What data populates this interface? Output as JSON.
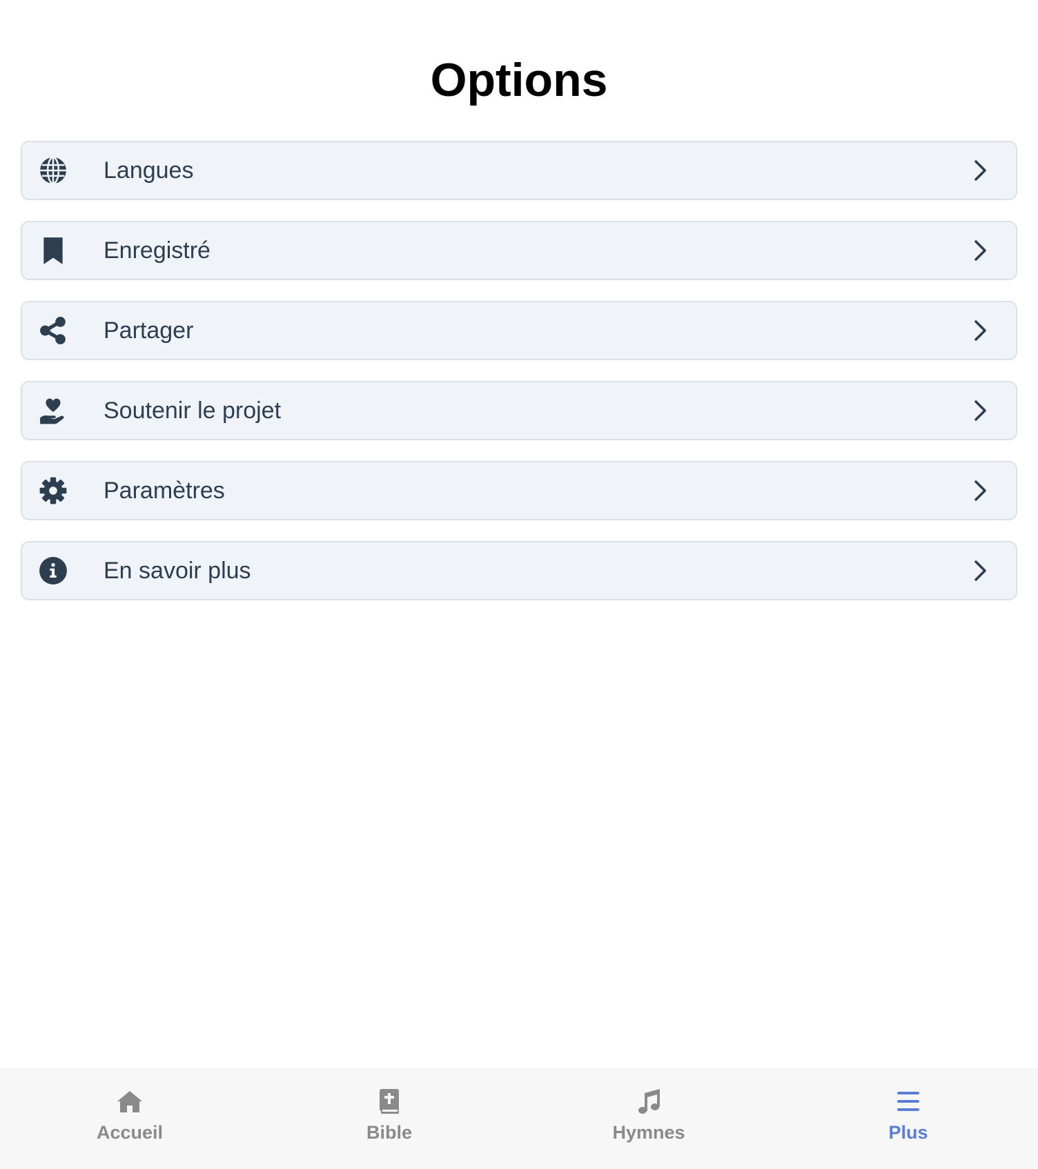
{
  "header": {
    "title": "Options"
  },
  "menu": {
    "items": [
      {
        "label": "Langues",
        "icon": "globe-icon"
      },
      {
        "label": "Enregistré",
        "icon": "bookmark-icon"
      },
      {
        "label": "Partager",
        "icon": "share-icon"
      },
      {
        "label": "Soutenir le projet",
        "icon": "hand-holding-heart-icon"
      },
      {
        "label": "Paramètres",
        "icon": "gear-icon"
      },
      {
        "label": "En savoir plus",
        "icon": "info-circle-icon"
      }
    ]
  },
  "tabbar": {
    "active": "Plus",
    "tabs": [
      {
        "label": "Accueil",
        "icon": "home-icon"
      },
      {
        "label": "Bible",
        "icon": "bible-icon"
      },
      {
        "label": "Hymnes",
        "icon": "music-note-icon"
      },
      {
        "label": "Plus",
        "icon": "menu-icon"
      }
    ]
  },
  "colors": {
    "text": "#2d3e50",
    "item_bg": "#f0f4f8",
    "item_border": "#d9e2ec",
    "tab_inactive": "#8a8a8a",
    "tab_active": "#5b7fd6"
  }
}
